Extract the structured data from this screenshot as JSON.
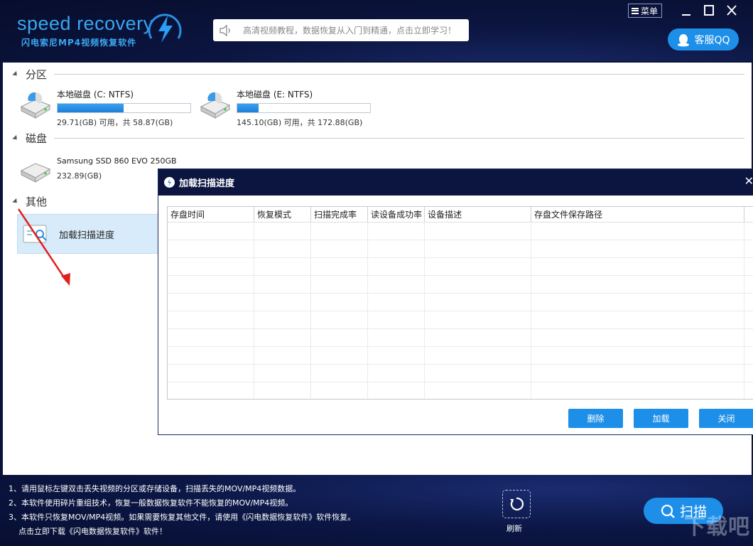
{
  "app": {
    "logo_text": "speed recovery",
    "logo_subtitle": "闪电索尼MP4视频恢复软件",
    "notice": "高清视频教程，数据恢复从入门到精通，点击立即学习！",
    "menu_label": "菜单",
    "qq_label": "客服QQ"
  },
  "sections": {
    "partition_label": "分区",
    "disk_label": "磁盘",
    "other_label": "其他"
  },
  "partitions": [
    {
      "name": "本地磁盘 (C: NTFS)",
      "info": "29.71(GB) 可用，共 58.87(GB)",
      "used_fraction": 0.495
    },
    {
      "name": "本地磁盘 (E: NTFS)",
      "info": "145.10(GB) 可用，共 172.88(GB)",
      "used_fraction": 0.16
    }
  ],
  "disks": [
    {
      "name": "Samsung SSD 860 EVO 250GB",
      "info": "232.89(GB)"
    }
  ],
  "other": {
    "load_item_label": "加载扫描进度"
  },
  "modal": {
    "title": "加载扫描进度",
    "columns": [
      "存盘时间",
      "恢复模式",
      "扫描完成率",
      "读设备成功率",
      "设备描述",
      "存盘文件保存路径"
    ],
    "rows": [],
    "buttons": {
      "delete": "删除",
      "load": "加载",
      "close": "关闭"
    }
  },
  "footer": {
    "tips": [
      "1、请用鼠标左键双击丢失视频的分区或存储设备，扫描丢失的MOV/MP4视频数据。",
      "2、本软件使用碎片重组技术，恢复一般数据恢复软件不能恢复的MOV/MP4视频。",
      "3、本软件只恢复MOV/MP4视频。如果需要恢复其他文件，请使用《闪电数据恢复软件》软件恢复。",
      "    点击立即下载《闪电数据恢复软件》软件！"
    ],
    "refresh_label": "刷新",
    "scan_label": "扫描",
    "watermark": "下载吧"
  }
}
